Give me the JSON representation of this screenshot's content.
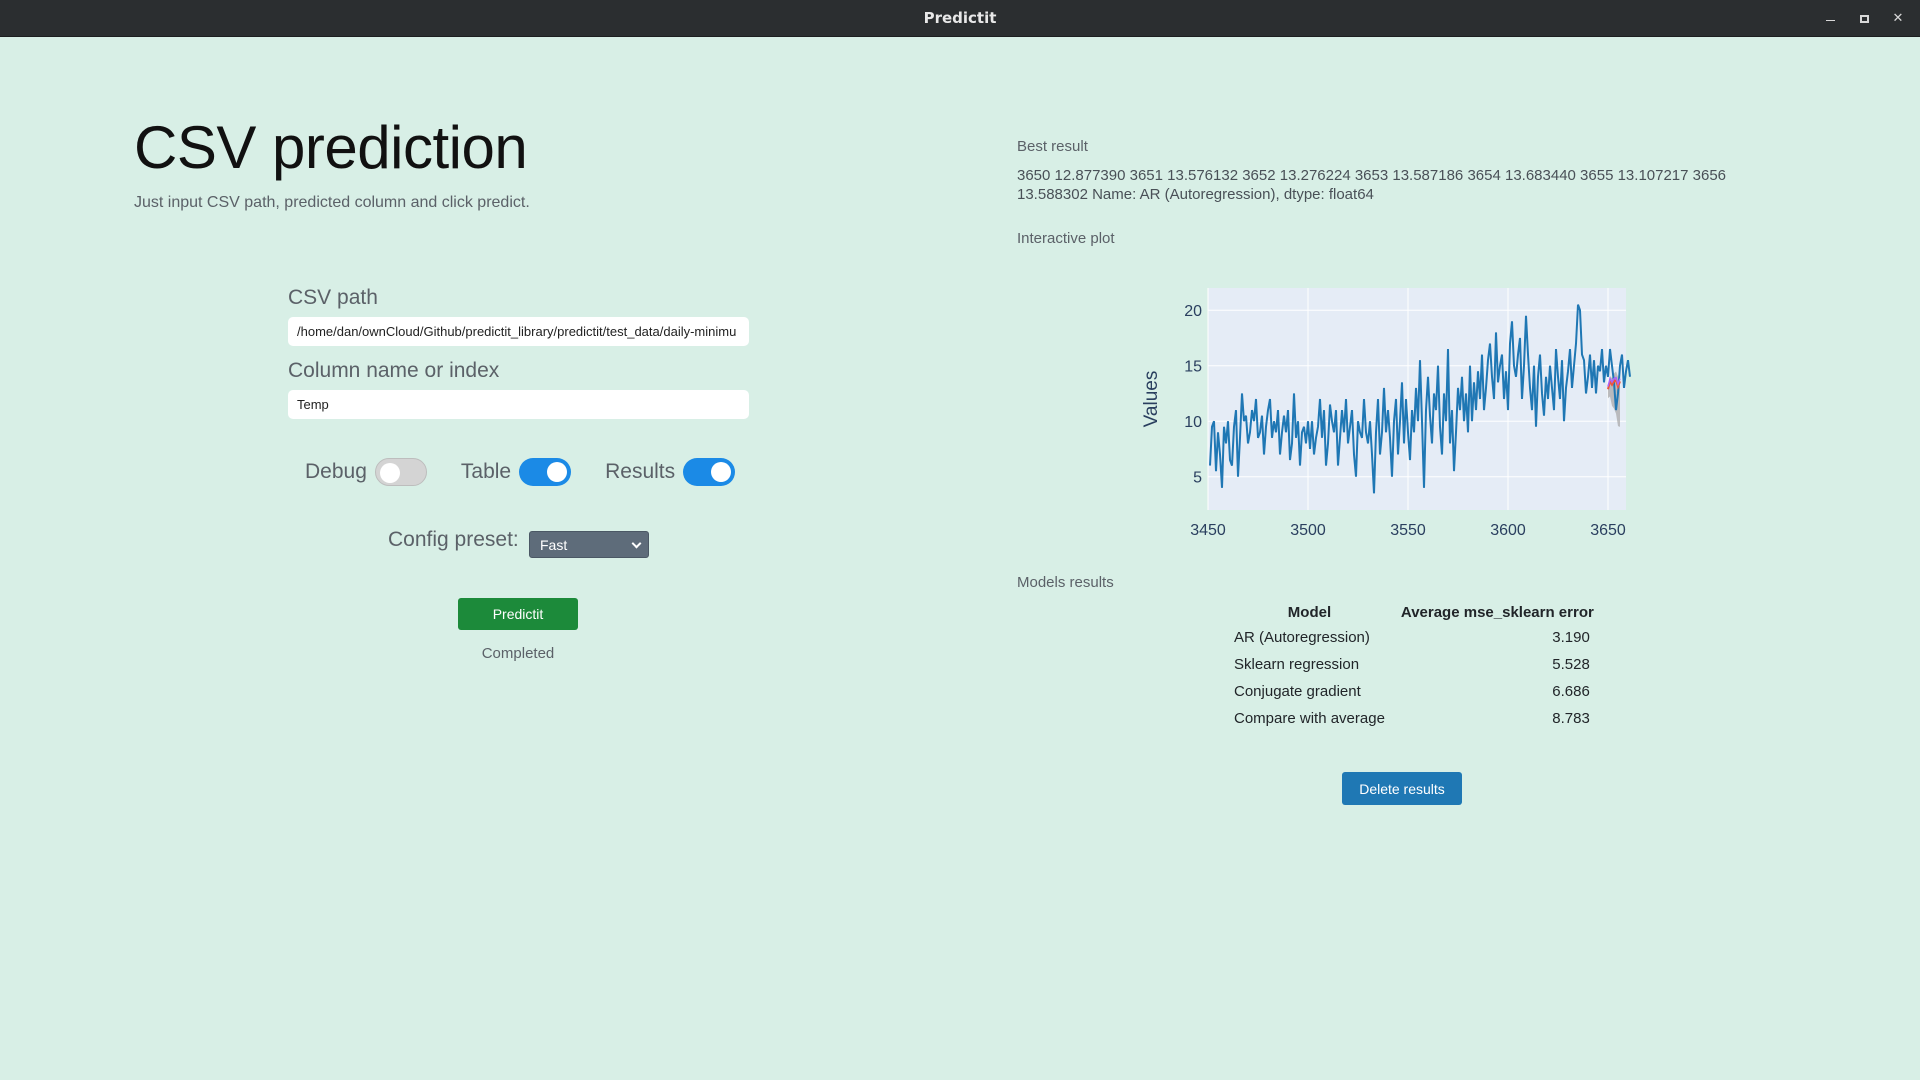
{
  "window": {
    "title": "Predictit",
    "controls": [
      "minimize",
      "maximize",
      "close"
    ]
  },
  "left": {
    "title": "CSV prediction",
    "subtitle": "Just input CSV path, predicted column and click predict.",
    "csv_path": {
      "label": "CSV path",
      "value": "/home/dan/ownCloud/Github/predictit_library/predictit/test_data/daily-minimu"
    },
    "column": {
      "label": "Column name or index",
      "value": "Temp"
    },
    "toggles": [
      {
        "label": "Debug",
        "on": false
      },
      {
        "label": "Table",
        "on": true
      },
      {
        "label": "Results",
        "on": true
      }
    ],
    "preset": {
      "label": "Config preset:",
      "selected": "Fast"
    },
    "predict_button": "Predictit",
    "status": "Completed"
  },
  "right": {
    "best_label": "Best result",
    "best_text": "3650 12.877390 3651 13.576132 3652 13.276224 3653 13.587186 3654 13.683440 3655 13.107217 3656 13.588302 Name: AR (Autoregression), dtype: float64",
    "plot_label": "Interactive plot",
    "models_label": "Models results",
    "table": {
      "headers": [
        "Model",
        "Average mse_sklearn error"
      ],
      "rows": [
        [
          "AR (Autoregression)",
          "3.190"
        ],
        [
          "Sklearn regression",
          "5.528"
        ],
        [
          "Conjugate gradient",
          "6.686"
        ],
        [
          "Compare with average",
          "8.783"
        ]
      ]
    },
    "delete_button": "Delete results"
  },
  "colors": {
    "background": "#d8efe6",
    "series": "#1f77b4",
    "forecast_fill": "#a9a9a9",
    "accent_switch": "#1b8ae6",
    "predict_button": "#1c8a3a",
    "delete_button": "#1f78b4"
  },
  "chart_data": {
    "type": "line",
    "ylabel": "Values",
    "xlim": [
      3450,
      3659
    ],
    "ylim": [
      2,
      22
    ],
    "xticks": [
      3450,
      3500,
      3550,
      3600,
      3650
    ],
    "yticks": [
      5,
      10,
      15,
      20
    ],
    "grid": true,
    "series": [
      {
        "x_start": 3451,
        "values": [
          6.0,
          9.5,
          10.0,
          5.5,
          9.0,
          7.0,
          4.0,
          9.5,
          8.0,
          10.0,
          6.5,
          6.0,
          9.5,
          11.0,
          5.0,
          8.5,
          12.5,
          10.0,
          10.5,
          8.0,
          9.0,
          11.0,
          10.0,
          12.0,
          8.5,
          9.0,
          10.5,
          7.0,
          9.5,
          11.0,
          12.0,
          8.5,
          10.0,
          9.0,
          11.0,
          7.0,
          9.0,
          10.5,
          9.0,
          11.0,
          6.5,
          8.0,
          12.5,
          8.5,
          10.0,
          6.0,
          9.0,
          9.5,
          8.0,
          10.0,
          7.5,
          10.0,
          7.0,
          8.5,
          9.5,
          12.0,
          8.5,
          11.0,
          6.0,
          8.0,
          11.5,
          10.0,
          9.0,
          11.0,
          6.0,
          8.5,
          11.0,
          9.0,
          12.0,
          8.0,
          9.5,
          11.0,
          7.0,
          5.0,
          10.0,
          9.0,
          8.5,
          12.0,
          9.0,
          8.0,
          10.0,
          7.0,
          3.5,
          9.0,
          12.0,
          7.0,
          9.0,
          13.0,
          9.0,
          11.0,
          8.5,
          5.0,
          10.0,
          12.0,
          7.0,
          10.0,
          13.5,
          8.0,
          12.0,
          9.0,
          6.5,
          11.0,
          9.0,
          13.0,
          10.0,
          15.5,
          10.0,
          4.0,
          11.0,
          14.0,
          10.5,
          8.0,
          12.5,
          11.0,
          15.0,
          9.5,
          7.0,
          12.5,
          10.0,
          16.5,
          8.0,
          11.0,
          5.5,
          9.0,
          13.0,
          11.0,
          14.0,
          10.0,
          12.5,
          9.0,
          15.0,
          10.0,
          13.5,
          11.0,
          14.5,
          12.0,
          16.0,
          11.0,
          13.0,
          15.5,
          17.0,
          14.0,
          12.0,
          18.0,
          13.5,
          15.0,
          16.0,
          12.0,
          14.5,
          11.0,
          17.0,
          19.0,
          15.0,
          14.0,
          16.0,
          17.5,
          12.0,
          15.0,
          19.5,
          16.0,
          13.0,
          11.0,
          15.0,
          9.5,
          14.0,
          16.0,
          12.5,
          10.5,
          14.0,
          12.0,
          15.0,
          13.0,
          11.0,
          16.5,
          14.0,
          12.0,
          15.5,
          10.0,
          13.0,
          14.5,
          16.5,
          13.0,
          15.0,
          17.0,
          20.5,
          20.0,
          16.0,
          15.5,
          12.5,
          14.0,
          16.0,
          13.0,
          15.5,
          12.5,
          15.0,
          14.5,
          16.5,
          13.5,
          15.0,
          14.0,
          16.5,
          15.0,
          13.5,
          11.0,
          12.5,
          15.0,
          16.0,
          13.0,
          14.5,
          15.5,
          14.0
        ]
      },
      {
        "name": "AR (Autoregression)",
        "x": [
          3650,
          3651,
          3652,
          3653,
          3654,
          3655,
          3656
        ],
        "values": [
          12.87739,
          13.576132,
          13.276224,
          13.587186,
          13.68344,
          13.107217,
          13.588302
        ]
      }
    ]
  }
}
